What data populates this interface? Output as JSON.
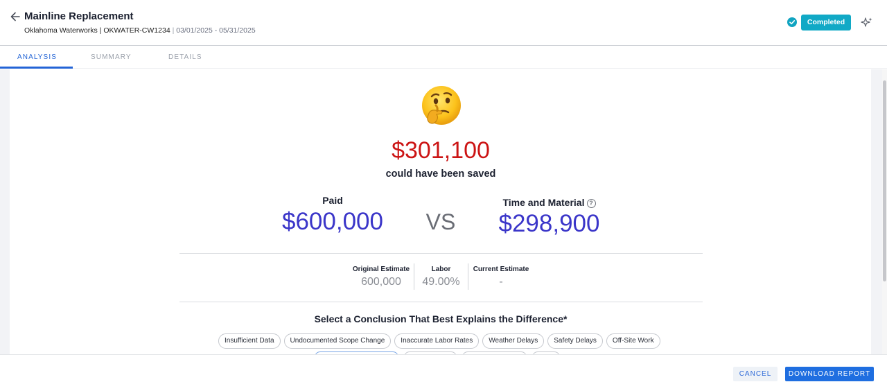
{
  "header": {
    "title": "Mainline Replacement",
    "organization": "Oklahoma Waterworks",
    "separator": "|",
    "project_code": "OKWATER-CW1234",
    "date_range": "03/01/2025 - 05/31/2025",
    "status": "Completed",
    "back_icon": "arrow-left-icon",
    "status_icon": "check-circle-icon",
    "ai_icon": "sparkle-icon",
    "status_color": "#11a9c6"
  },
  "tabs": [
    {
      "label": "ANALYSIS",
      "active": true
    },
    {
      "label": "SUMMARY",
      "active": false
    },
    {
      "label": "DETAILS",
      "active": false
    }
  ],
  "analysis": {
    "emoji": "thinking-face-emoji",
    "saved_amount": "$301,100",
    "saved_caption": "could have been saved",
    "paid_label": "Paid",
    "paid_value": "$600,000",
    "vs": "VS",
    "tm_label": "Time and Material",
    "tm_help_icon": "question-circle-icon",
    "tm_value": "$298,900",
    "estimates": [
      {
        "label": "Original Estimate",
        "value": "600,000"
      },
      {
        "label": "Labor",
        "value": "49.00%"
      },
      {
        "label": "Current Estimate",
        "value": "-"
      }
    ],
    "conclusion_title": "Select a Conclusion That Best Explains the Difference*",
    "conclusions": [
      "Insufficient Data",
      "Undocumented Scope Change",
      "Inaccurate Labor Rates",
      "Weather Delays",
      "Safety Delays",
      "Off-Site Work"
    ]
  },
  "footer": {
    "cancel": "CANCEL",
    "download": "DOWNLOAD REPORT"
  },
  "colors": {
    "accent": "#2364d6",
    "saved": "#cc1414",
    "amount": "#3b36c9"
  }
}
